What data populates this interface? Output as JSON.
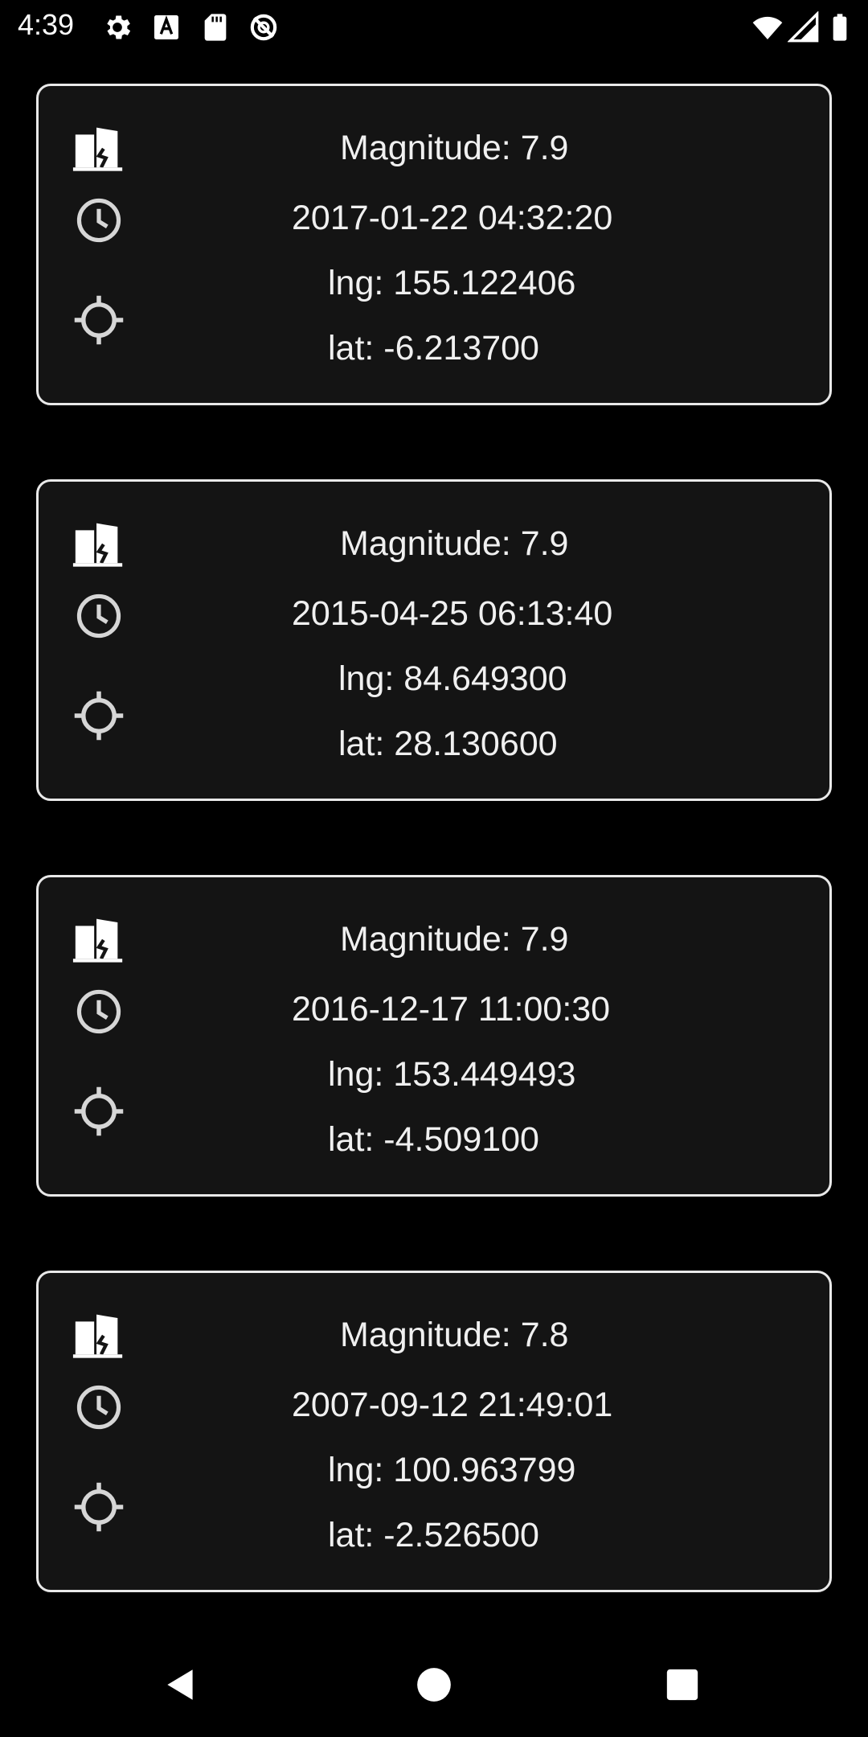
{
  "status_bar": {
    "time": "4:39",
    "left_icons": [
      "settings-icon",
      "keyboard-a-icon",
      "sd-card-icon",
      "no-location-icon"
    ],
    "right_icons": [
      "wifi-icon",
      "signal-icon",
      "battery-icon"
    ]
  },
  "earthquakes": [
    {
      "magnitude": "Magnitude: 7.9",
      "time": "2017-01-22 04:32:20",
      "lng": "lng: 155.122406",
      "lat": "lat: -6.213700"
    },
    {
      "magnitude": "Magnitude: 7.9",
      "time": "2015-04-25 06:13:40",
      "lng": "lng: 84.649300",
      "lat": "lat: 28.130600"
    },
    {
      "magnitude": "Magnitude: 7.9",
      "time": "2016-12-17 11:00:30",
      "lng": "lng: 153.449493",
      "lat": "lat: -4.509100"
    },
    {
      "magnitude": "Magnitude: 7.8",
      "time": "2007-09-12 21:49:01",
      "lng": "lng: 100.963799",
      "lat": "lat: -2.526500"
    }
  ],
  "card_icons": {
    "magnitude": "earthquake-buildings-icon",
    "time": "clock-icon",
    "location": "crosshair-icon"
  },
  "nav_bar": {
    "back": "back-triangle-icon",
    "home": "home-circle-icon",
    "recents": "recents-square-icon"
  },
  "colors": {
    "background": "#000000",
    "card_background": "#141414",
    "card_border": "#e9e9e9",
    "text": "#f0f0f0",
    "icon": "#d6d6d6"
  }
}
